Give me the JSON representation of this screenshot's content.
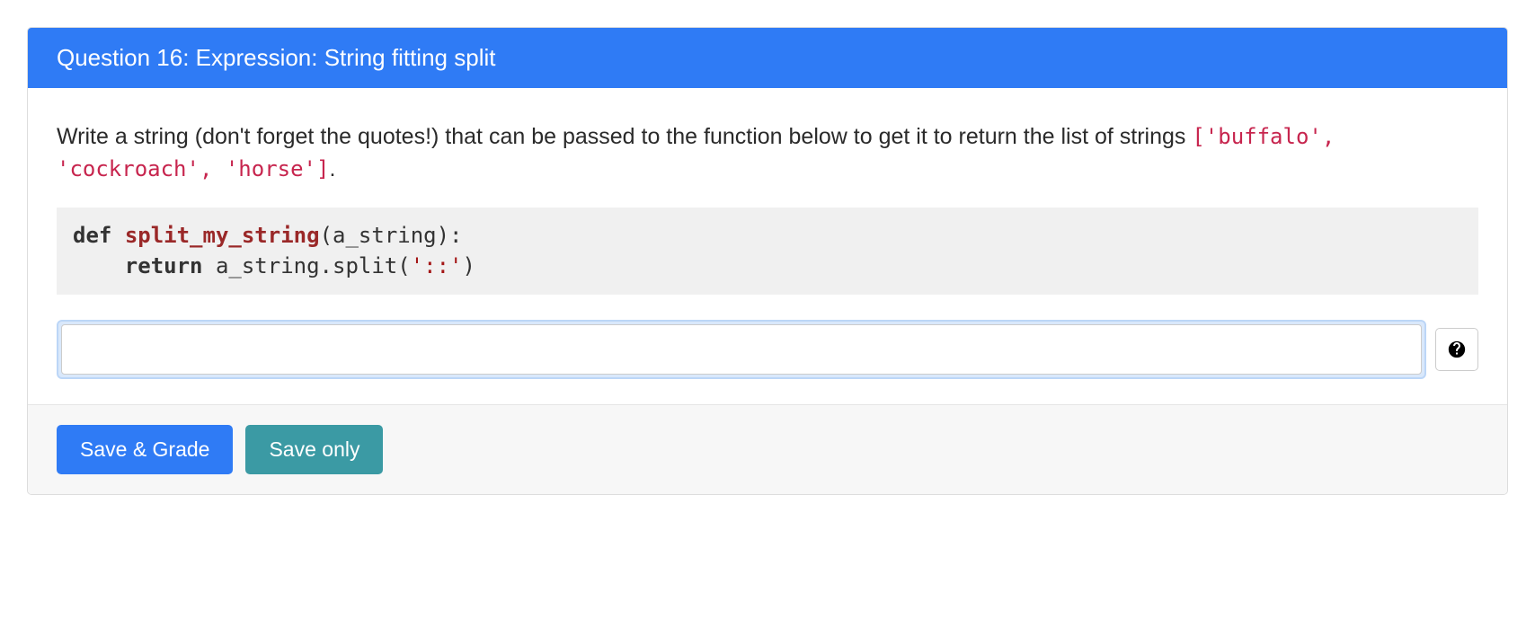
{
  "header": {
    "title": "Question 16: Expression: String fitting split"
  },
  "prompt": {
    "intro": "Write a string (don't forget the quotes!) that can be passed to the function below to get it to return the list of strings ",
    "target_list": "['buffalo', 'cockroach', 'horse']",
    "after": "."
  },
  "code": {
    "kw_def": "def",
    "fn_name": "split_my_string",
    "open_paren": "(",
    "param": "a_string",
    "close_sig": "):",
    "indent": "    ",
    "kw_return": "return",
    "expr_prefix": " a_string.split(",
    "str_arg": "'::'",
    "expr_suffix": ")"
  },
  "answer": {
    "value": "",
    "placeholder": ""
  },
  "help": {
    "icon_name": "help-circle-icon"
  },
  "footer": {
    "save_grade_label": "Save & Grade",
    "save_only_label": "Save only"
  }
}
